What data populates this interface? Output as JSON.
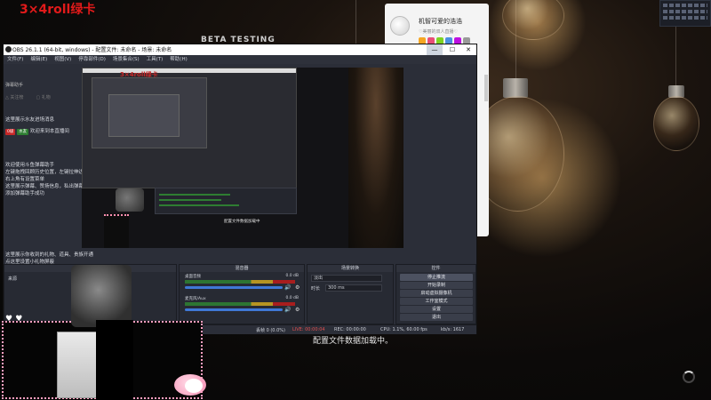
{
  "overlay": {
    "title": "3×4roll绿卡",
    "beta": "BETA TESTING",
    "loading": "配置文件数据加载中。"
  },
  "chat_card": {
    "name": "机智可爱的浩浩",
    "sub": "♡美丽的双人直播♡"
  },
  "obs": {
    "title": "OBS 26.1.1 (64-bit, windows) - 配置文件: 未命名 - 场景: 未命名",
    "win_buttons": {
      "min": "—",
      "max": "☐",
      "close": "✕"
    },
    "menu": [
      "文件(F)",
      "编辑(E)",
      "视图(V)",
      "停靠部件(D)",
      "场景集合(S)",
      "工具(T)",
      "帮助(H)"
    ],
    "left": {
      "header": "弹幕助手",
      "controls": [
        "△ 关注榜",
        "▢ 礼物"
      ],
      "messages": [
        "这里展示水友进场消息",
        "欢迎来到本直播间",
        "欢迎使用斗鱼弹幕助手",
        "左键拖拽回顾历史位置，左键拉伸边框改变大小",
        "右上角有设置菜单",
        "这里展示弹幕、赞扬信息，私出弹幕信息",
        "添加弹幕助手成功",
        "这里展示你收到的礼物、道具、贵族开通",
        "点这里设置小礼物屏蔽"
      ],
      "badge1": "0级",
      "badge2": "水友"
    },
    "preview_caption": "配置文件数据加载中",
    "docks": {
      "scene": "场景",
      "sources": "来源",
      "mixer": "混音器",
      "transitions": "场景转换",
      "controls": "控件"
    },
    "mixer": {
      "ch1": "桌面音频",
      "ch2": "麦克风/Aux",
      "db1": "0.0 dB",
      "db2": "0.0 dB"
    },
    "transitions": {
      "selected": "淡出",
      "duration_label": "时长",
      "duration": "300 ms"
    },
    "controls": [
      "停止推流",
      "开始录制",
      "启动虚拟摄像机",
      "工作室模式",
      "设置",
      "退出"
    ],
    "status": {
      "dropped": "丢帧 0 (0.0%)",
      "live": "LIVE: 00:00:04",
      "rec": "REC: 00:00:00",
      "cpu": "CPU: 1.1%, 60.00 fps",
      "kbps": "kb/s: 1617"
    }
  },
  "colors": {
    "overlay_title": "#e11a1a",
    "obs_bg": "#2b2e38",
    "accent_blue": "#3f78d6",
    "pink": "#ff9fc0"
  }
}
